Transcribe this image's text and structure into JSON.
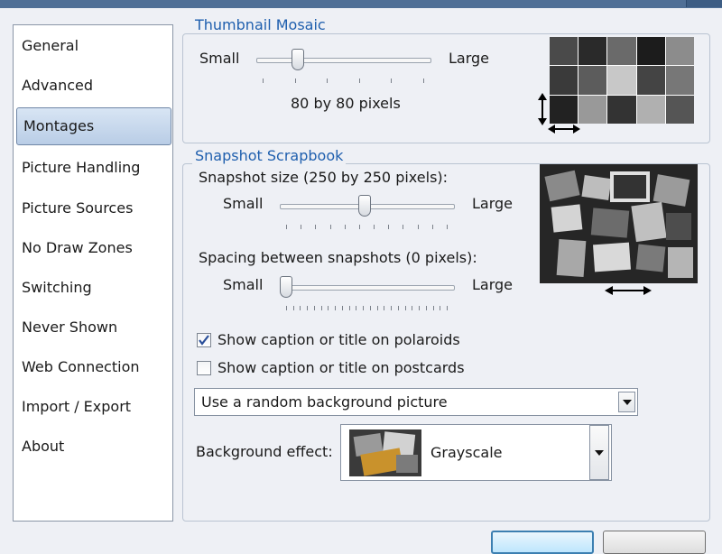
{
  "sidebar": {
    "items": [
      {
        "label": "General"
      },
      {
        "label": "Advanced"
      },
      {
        "label": "Montages",
        "selected": true
      },
      {
        "label": "Picture Handling"
      },
      {
        "label": "Picture Sources"
      },
      {
        "label": "No Draw Zones"
      },
      {
        "label": "Switching"
      },
      {
        "label": "Never Shown"
      },
      {
        "label": "Web Connection"
      },
      {
        "label": "Import / Export"
      },
      {
        "label": "About"
      }
    ]
  },
  "thumbnail_mosaic": {
    "title": "Thumbnail Mosaic",
    "small_label": "Small",
    "large_label": "Large",
    "size_text": "80 by 80 pixels",
    "slider_fraction": 0.22
  },
  "snapshot_scrapbook": {
    "title": "Snapshot Scrapbook",
    "size_label": "Snapshot size (250 by 250 pixels):",
    "size_small": "Small",
    "size_large": "Large",
    "size_slider_fraction": 0.49,
    "spacing_label": "Spacing between snapshots (0 pixels):",
    "spacing_small": "Small",
    "spacing_large": "Large",
    "spacing_slider_fraction": 0.0,
    "caption_polaroids": {
      "label": "Show caption or title on polaroids",
      "checked": true
    },
    "caption_postcards": {
      "label": "Show caption or title on postcards",
      "checked": false
    },
    "background_select": {
      "value": "Use a random background picture"
    },
    "background_effect": {
      "label": "Background effect:",
      "value": "Grayscale"
    }
  },
  "colors": {
    "group_title": "#1f5fae",
    "selected_nav": "#c7d8ee",
    "check_mark": "#2a4f9a"
  }
}
